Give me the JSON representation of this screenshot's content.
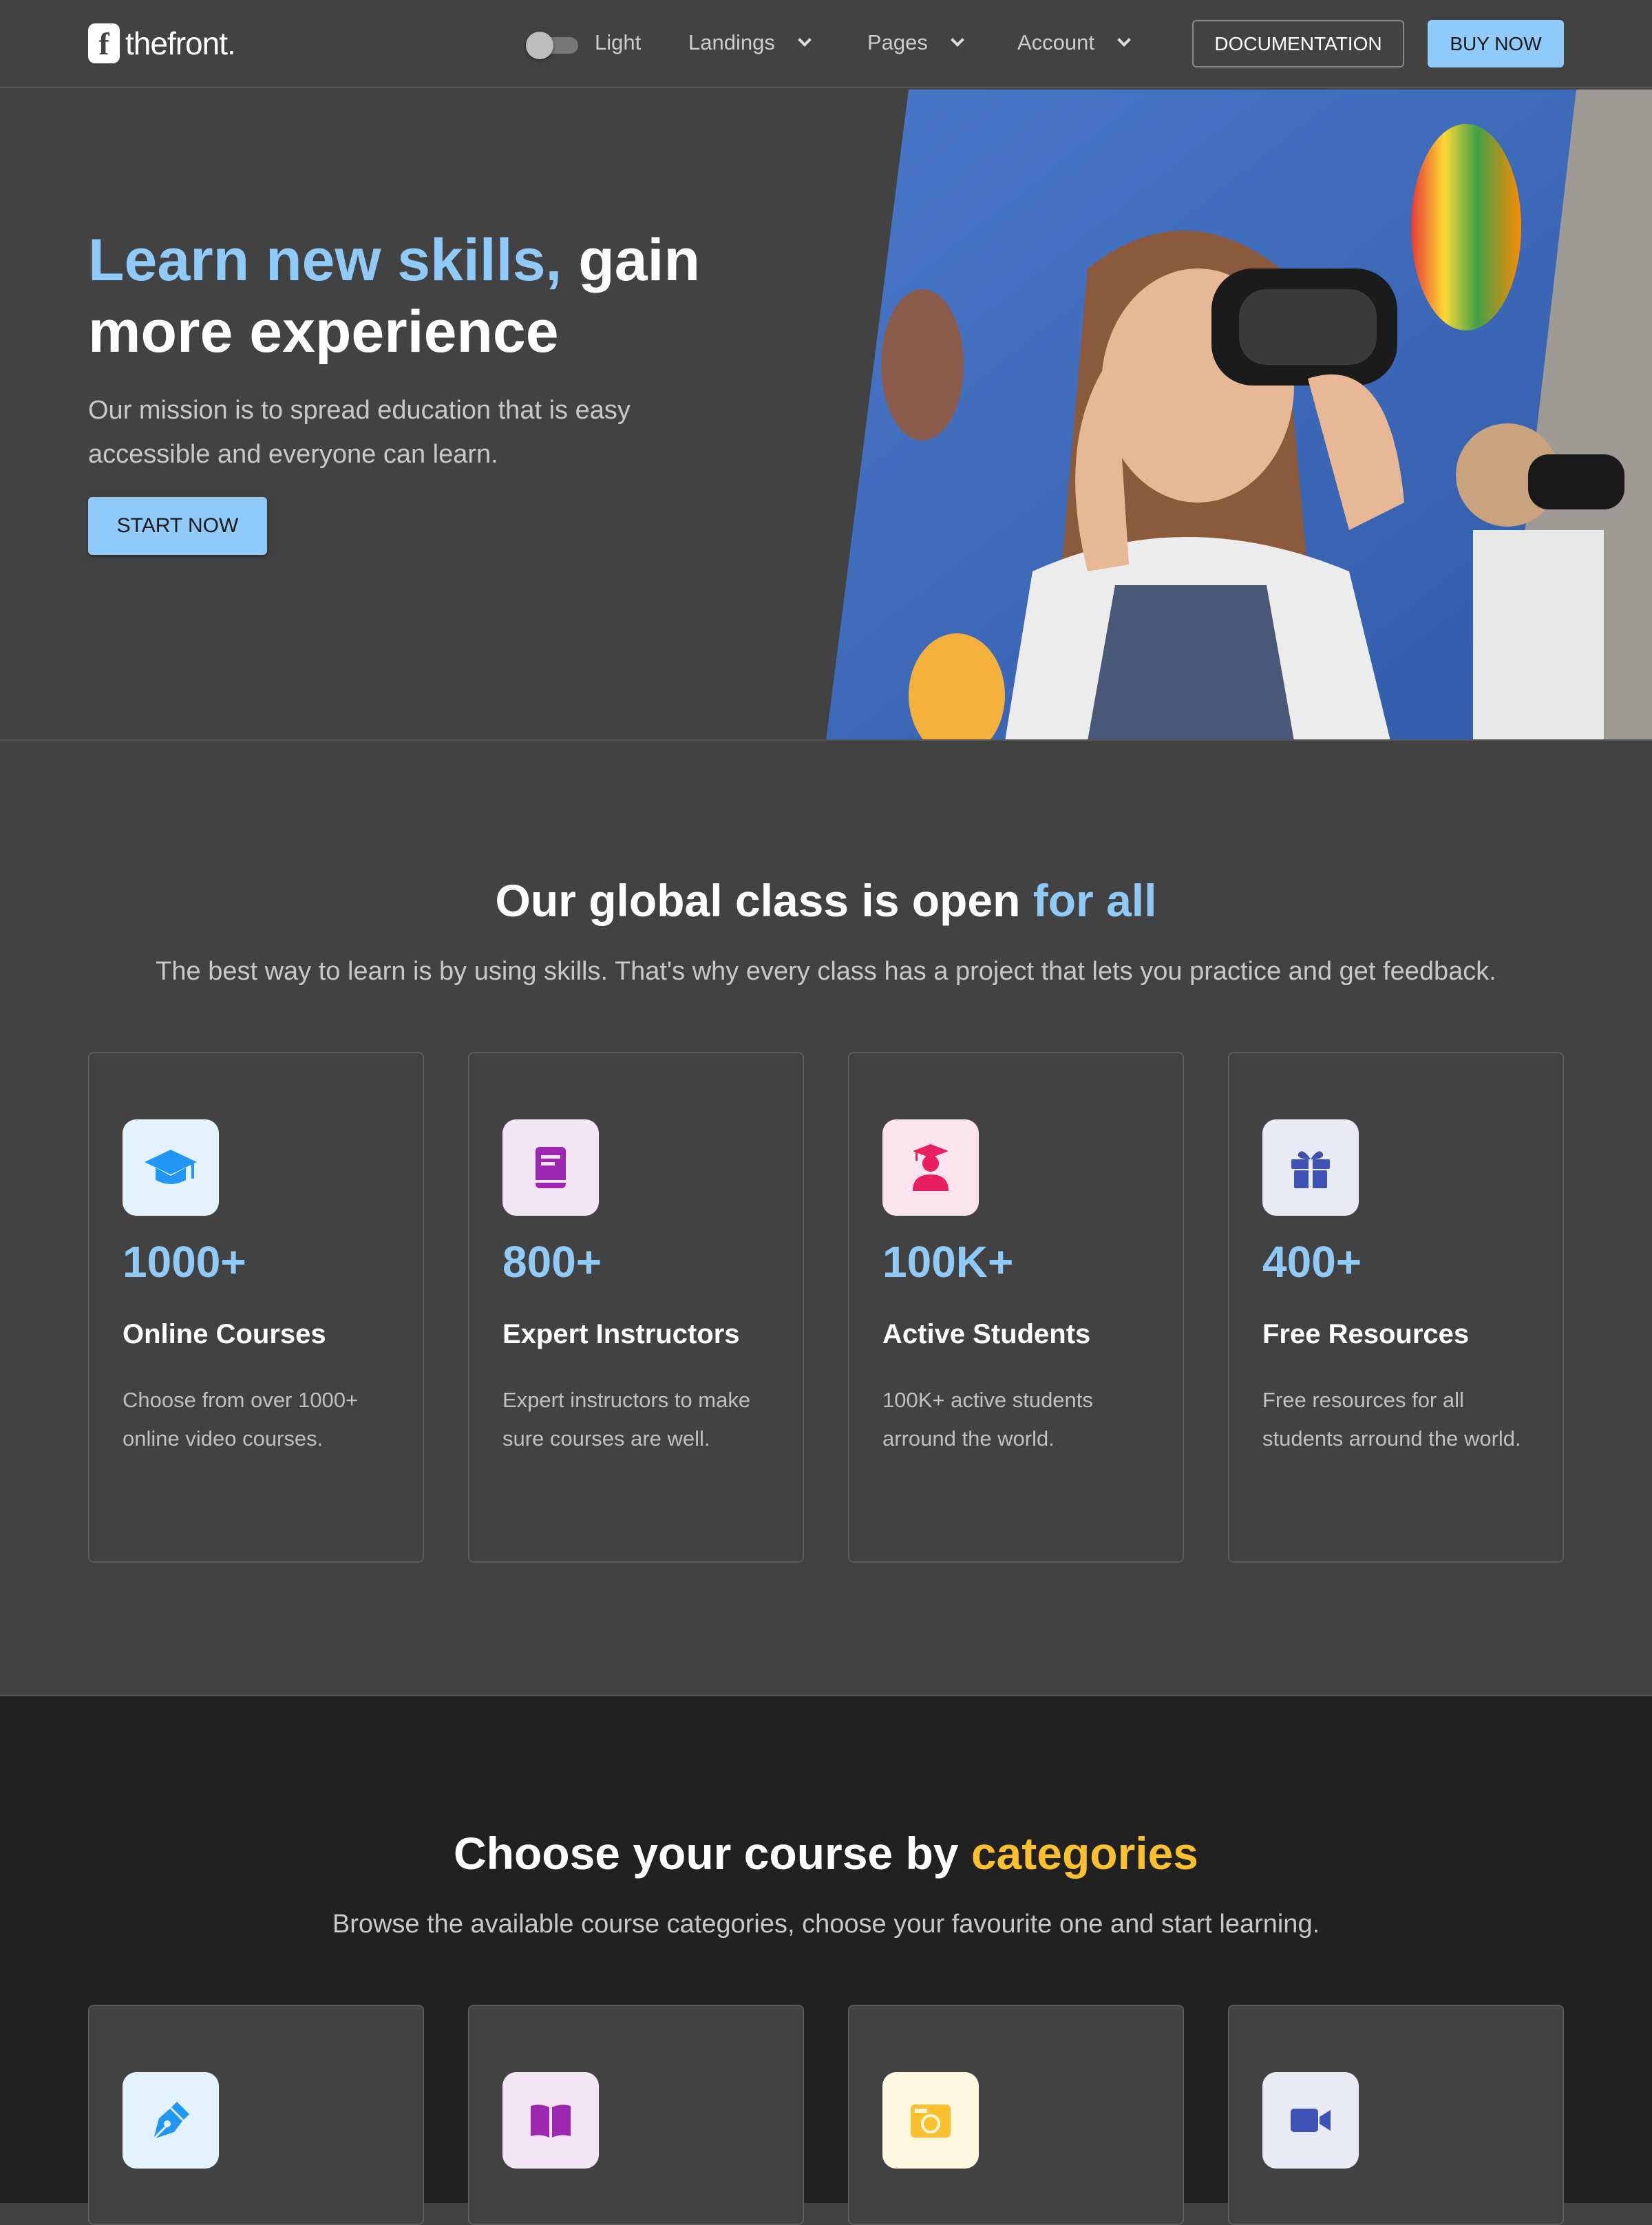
{
  "header": {
    "logo_text": "thefront.",
    "logo_mark": "f",
    "theme_label": "Light",
    "nav": [
      {
        "label": "Landings"
      },
      {
        "label": "Pages"
      },
      {
        "label": "Account"
      }
    ],
    "documentation_label": "DOCUMENTATION",
    "buy_label": "BUY NOW"
  },
  "hero": {
    "title_highlight": "Learn new skills,",
    "title_rest": " gain more experience",
    "subtitle": "Our mission is to spread education that is easy accessible and everyone can learn.",
    "cta_label": "START NOW"
  },
  "global": {
    "title_plain": "Our global class is open ",
    "title_highlight": "for all",
    "subtitle": "The best way to learn is by using skills. That's why every class has a project that lets you practice and get feedback.",
    "cards": [
      {
        "number": "1000+",
        "title": "Online Courses",
        "description": "Choose from over 1000+ online video courses.",
        "icon": "graduation-cap-icon",
        "icon_bg": "#e3f2fd",
        "icon_color": "#2196f3"
      },
      {
        "number": "800+",
        "title": "Expert Instructors",
        "description": "Expert instructors to make sure courses are well.",
        "icon": "book-icon",
        "icon_bg": "#f3e5f5",
        "icon_color": "#9c27b0"
      },
      {
        "number": "100K+",
        "title": "Active Students",
        "description": "100K+ active students arround the world.",
        "icon": "student-icon",
        "icon_bg": "#fce4ec",
        "icon_color": "#e91e63"
      },
      {
        "number": "400+",
        "title": "Free Resources",
        "description": "Free resources for all students arround the world.",
        "icon": "gift-icon",
        "icon_bg": "#e8eaf6",
        "icon_color": "#3f51b5"
      }
    ]
  },
  "categories": {
    "title_plain": "Choose your course by ",
    "title_highlight": "categories",
    "subtitle": "Browse the available course categories, choose your favourite one and start learning.",
    "cards": [
      {
        "icon": "pen-nib-icon",
        "icon_bg": "#e3f2fd",
        "icon_color": "#2196f3"
      },
      {
        "icon": "open-book-icon",
        "icon_bg": "#f3e5f5",
        "icon_color": "#9c27b0"
      },
      {
        "icon": "camera-icon",
        "icon_bg": "#fff8e1",
        "icon_color": "#fbc02d"
      },
      {
        "icon": "video-camera-icon",
        "icon_bg": "#e8eaf6",
        "icon_color": "#3f51b5"
      }
    ]
  },
  "colors": {
    "accent": "#90caf9",
    "category_accent": "#fbc02d"
  }
}
